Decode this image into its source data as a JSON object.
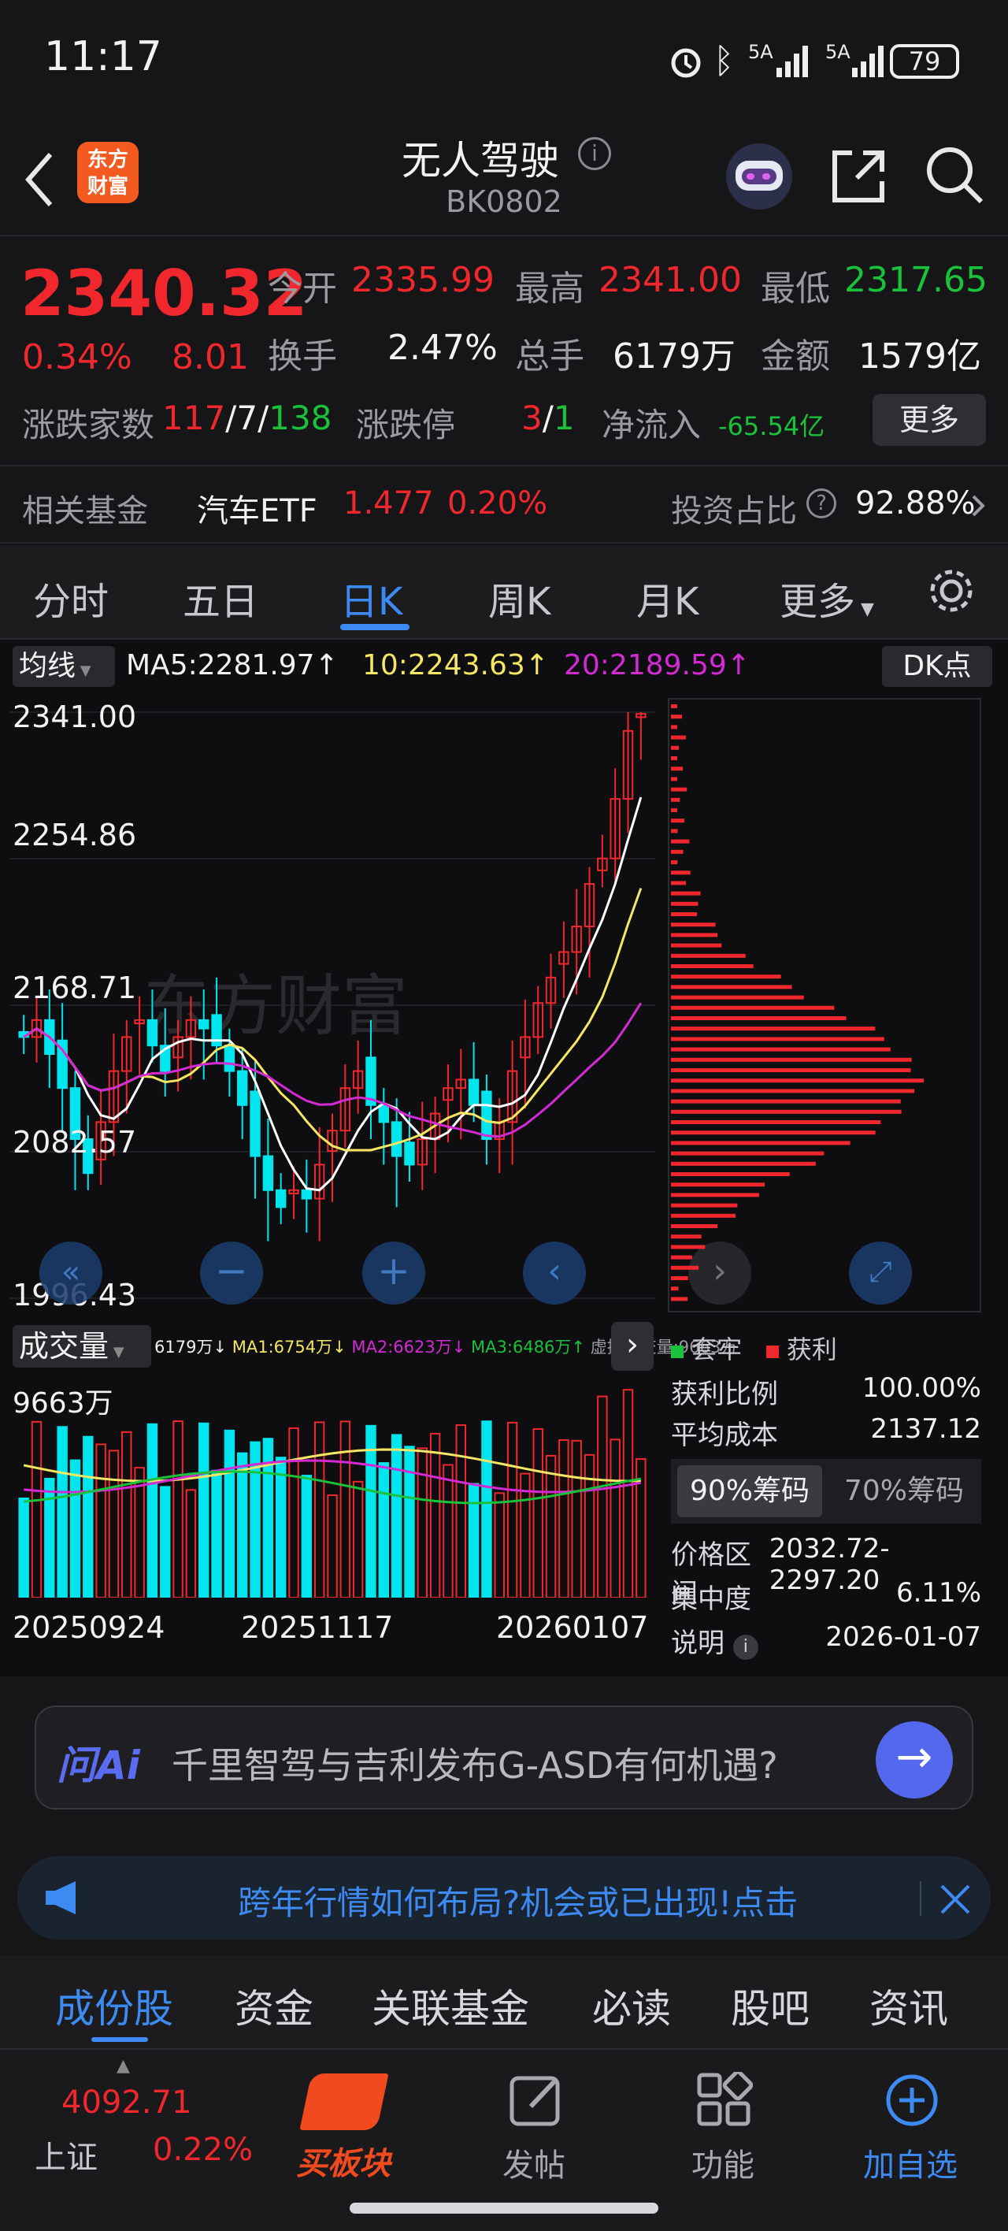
{
  "status": {
    "time": "11:17",
    "battery": "79",
    "net1": "5A",
    "net2": "5A"
  },
  "header": {
    "title": "无人驾驶",
    "code": "BK0802",
    "logo_line1": "东方",
    "logo_line2": "财富"
  },
  "quote": {
    "price": "2340.32",
    "pct": "0.34%",
    "chg": "8.01",
    "open_label": "今开",
    "open": "2335.99",
    "high_label": "最高",
    "high": "2341.00",
    "low_label": "最低",
    "low": "2317.65",
    "turnover_label": "换手",
    "turnover": "2.47%",
    "volume_label": "总手",
    "volume": "6179万",
    "amount_label": "金额",
    "amount": "1579亿",
    "updown_label": "涨跌家数",
    "up": "117",
    "flat": "7",
    "down": "138",
    "limit_label": "涨跌停",
    "limit_up": "3",
    "limit_down": "1",
    "netflow_label": "净流入",
    "netflow": "-65.54亿",
    "more": "更多"
  },
  "fund": {
    "label": "相关基金",
    "name": "汽车ETF",
    "price": "1.477",
    "pct": "0.20%",
    "ratio_label": "投资占比",
    "ratio": "92.88%"
  },
  "tabs": [
    "分时",
    "五日",
    "日K",
    "周K",
    "月K",
    "更多"
  ],
  "ma": {
    "btn": "均线",
    "ma5": "MA5:2281.97↑",
    "ma10": "10:2243.63↑",
    "ma20": "20:2189.59↑",
    "dk": "DK点"
  },
  "price_axis": [
    "2341.00",
    "2254.86",
    "2168.71",
    "2082.57",
    "1996.43"
  ],
  "watermark": "东方财富",
  "volume_panel": {
    "btn": "成交量",
    "info": [
      "6179万↓",
      "MA1:6754万↓",
      "MA2:6623万↓",
      "MA3:6486万↑",
      "虚拟成交量:9663万"
    ],
    "max": "9663万"
  },
  "dates": [
    "20250924",
    "20251117",
    "20260107"
  ],
  "chips": {
    "legend_trapped": "套牢",
    "legend_profit": "获利",
    "rows": [
      {
        "k": "获利比例",
        "v": "100.00%"
      },
      {
        "k": "平均成本",
        "v": "2137.12"
      }
    ],
    "tab90": "90%筹码",
    "tab70": "70%筹码",
    "rows2": [
      {
        "k": "价格区间",
        "v": "2032.72-2297.20"
      },
      {
        "k": "集中度",
        "v": "6.11%"
      },
      {
        "k": "说明",
        "v": "2026-01-07"
      }
    ]
  },
  "ask": {
    "logo": "问Ai",
    "text": "千里智驾与吉利发布G-ASD有何机遇?"
  },
  "banner": {
    "text": "跨年行情如何布局?机会或已出现!点击"
  },
  "subtabs": [
    "成份股",
    "资金",
    "关联基金",
    "必读",
    "股吧",
    "资讯"
  ],
  "bottom": {
    "index_value": "4092.71",
    "index_name": "上证",
    "index_pct": "0.22%",
    "buy": "买板块",
    "post": "发帖",
    "func": "功能",
    "add": "加自选"
  },
  "colors": {
    "up": "#f0272d",
    "down": "#19c23a",
    "accent": "#3d8bf2",
    "cyan": "#00e5ee",
    "ma5": "#ffffff",
    "ma10": "#f5e663",
    "ma20": "#d42ad4"
  },
  "chart_data": {
    "type": "candlestick",
    "close": [
      2150,
      2160,
      2140,
      2120,
      2090,
      2070,
      2100,
      2130,
      2150,
      2160,
      2145,
      2130,
      2150,
      2160,
      2155,
      2145,
      2130,
      2110,
      2080,
      2060,
      2050,
      2060,
      2055,
      2075,
      2095,
      2120,
      2130,
      2110,
      2100,
      2080,
      2075,
      2090,
      2105,
      2120,
      2125,
      2110,
      2090,
      2100,
      2130,
      2150,
      2170,
      2185,
      2200,
      2215,
      2240,
      2255,
      2290,
      2330,
      2340
    ],
    "ma5_last": 2281.97,
    "ma10_last": 2243.63,
    "ma20_last": 2189.59,
    "y_range": [
      1996.43,
      2341.0
    ]
  }
}
